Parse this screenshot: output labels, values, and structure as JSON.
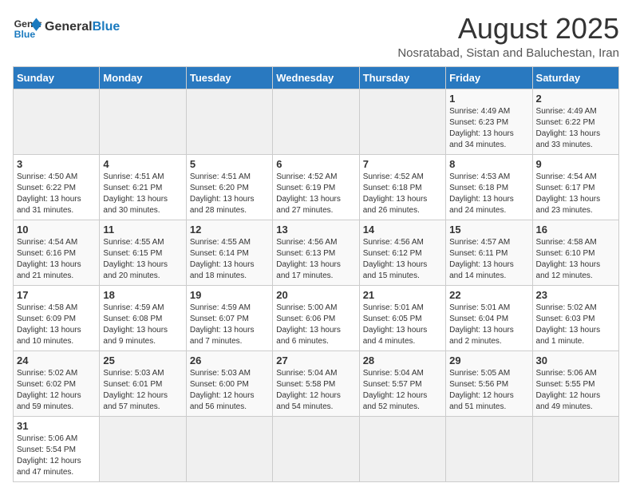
{
  "header": {
    "logo_line1": "General",
    "logo_line2": "Blue",
    "title": "August 2025",
    "subtitle": "Nosratabad, Sistan and Baluchestan, Iran"
  },
  "days_of_week": [
    "Sunday",
    "Monday",
    "Tuesday",
    "Wednesday",
    "Thursday",
    "Friday",
    "Saturday"
  ],
  "weeks": [
    {
      "days": [
        {
          "num": "",
          "info": ""
        },
        {
          "num": "",
          "info": ""
        },
        {
          "num": "",
          "info": ""
        },
        {
          "num": "",
          "info": ""
        },
        {
          "num": "",
          "info": ""
        },
        {
          "num": "1",
          "info": "Sunrise: 4:49 AM\nSunset: 6:23 PM\nDaylight: 13 hours\nand 34 minutes."
        },
        {
          "num": "2",
          "info": "Sunrise: 4:49 AM\nSunset: 6:22 PM\nDaylight: 13 hours\nand 33 minutes."
        }
      ]
    },
    {
      "days": [
        {
          "num": "3",
          "info": "Sunrise: 4:50 AM\nSunset: 6:22 PM\nDaylight: 13 hours\nand 31 minutes."
        },
        {
          "num": "4",
          "info": "Sunrise: 4:51 AM\nSunset: 6:21 PM\nDaylight: 13 hours\nand 30 minutes."
        },
        {
          "num": "5",
          "info": "Sunrise: 4:51 AM\nSunset: 6:20 PM\nDaylight: 13 hours\nand 28 minutes."
        },
        {
          "num": "6",
          "info": "Sunrise: 4:52 AM\nSunset: 6:19 PM\nDaylight: 13 hours\nand 27 minutes."
        },
        {
          "num": "7",
          "info": "Sunrise: 4:52 AM\nSunset: 6:18 PM\nDaylight: 13 hours\nand 26 minutes."
        },
        {
          "num": "8",
          "info": "Sunrise: 4:53 AM\nSunset: 6:18 PM\nDaylight: 13 hours\nand 24 minutes."
        },
        {
          "num": "9",
          "info": "Sunrise: 4:54 AM\nSunset: 6:17 PM\nDaylight: 13 hours\nand 23 minutes."
        }
      ]
    },
    {
      "days": [
        {
          "num": "10",
          "info": "Sunrise: 4:54 AM\nSunset: 6:16 PM\nDaylight: 13 hours\nand 21 minutes."
        },
        {
          "num": "11",
          "info": "Sunrise: 4:55 AM\nSunset: 6:15 PM\nDaylight: 13 hours\nand 20 minutes."
        },
        {
          "num": "12",
          "info": "Sunrise: 4:55 AM\nSunset: 6:14 PM\nDaylight: 13 hours\nand 18 minutes."
        },
        {
          "num": "13",
          "info": "Sunrise: 4:56 AM\nSunset: 6:13 PM\nDaylight: 13 hours\nand 17 minutes."
        },
        {
          "num": "14",
          "info": "Sunrise: 4:56 AM\nSunset: 6:12 PM\nDaylight: 13 hours\nand 15 minutes."
        },
        {
          "num": "15",
          "info": "Sunrise: 4:57 AM\nSunset: 6:11 PM\nDaylight: 13 hours\nand 14 minutes."
        },
        {
          "num": "16",
          "info": "Sunrise: 4:58 AM\nSunset: 6:10 PM\nDaylight: 13 hours\nand 12 minutes."
        }
      ]
    },
    {
      "days": [
        {
          "num": "17",
          "info": "Sunrise: 4:58 AM\nSunset: 6:09 PM\nDaylight: 13 hours\nand 10 minutes."
        },
        {
          "num": "18",
          "info": "Sunrise: 4:59 AM\nSunset: 6:08 PM\nDaylight: 13 hours\nand 9 minutes."
        },
        {
          "num": "19",
          "info": "Sunrise: 4:59 AM\nSunset: 6:07 PM\nDaylight: 13 hours\nand 7 minutes."
        },
        {
          "num": "20",
          "info": "Sunrise: 5:00 AM\nSunset: 6:06 PM\nDaylight: 13 hours\nand 6 minutes."
        },
        {
          "num": "21",
          "info": "Sunrise: 5:01 AM\nSunset: 6:05 PM\nDaylight: 13 hours\nand 4 minutes."
        },
        {
          "num": "22",
          "info": "Sunrise: 5:01 AM\nSunset: 6:04 PM\nDaylight: 13 hours\nand 2 minutes."
        },
        {
          "num": "23",
          "info": "Sunrise: 5:02 AM\nSunset: 6:03 PM\nDaylight: 13 hours\nand 1 minute."
        }
      ]
    },
    {
      "days": [
        {
          "num": "24",
          "info": "Sunrise: 5:02 AM\nSunset: 6:02 PM\nDaylight: 12 hours\nand 59 minutes."
        },
        {
          "num": "25",
          "info": "Sunrise: 5:03 AM\nSunset: 6:01 PM\nDaylight: 12 hours\nand 57 minutes."
        },
        {
          "num": "26",
          "info": "Sunrise: 5:03 AM\nSunset: 6:00 PM\nDaylight: 12 hours\nand 56 minutes."
        },
        {
          "num": "27",
          "info": "Sunrise: 5:04 AM\nSunset: 5:58 PM\nDaylight: 12 hours\nand 54 minutes."
        },
        {
          "num": "28",
          "info": "Sunrise: 5:04 AM\nSunset: 5:57 PM\nDaylight: 12 hours\nand 52 minutes."
        },
        {
          "num": "29",
          "info": "Sunrise: 5:05 AM\nSunset: 5:56 PM\nDaylight: 12 hours\nand 51 minutes."
        },
        {
          "num": "30",
          "info": "Sunrise: 5:06 AM\nSunset: 5:55 PM\nDaylight: 12 hours\nand 49 minutes."
        }
      ]
    },
    {
      "days": [
        {
          "num": "31",
          "info": "Sunrise: 5:06 AM\nSunset: 5:54 PM\nDaylight: 12 hours\nand 47 minutes."
        },
        {
          "num": "",
          "info": ""
        },
        {
          "num": "",
          "info": ""
        },
        {
          "num": "",
          "info": ""
        },
        {
          "num": "",
          "info": ""
        },
        {
          "num": "",
          "info": ""
        },
        {
          "num": "",
          "info": ""
        }
      ]
    }
  ]
}
